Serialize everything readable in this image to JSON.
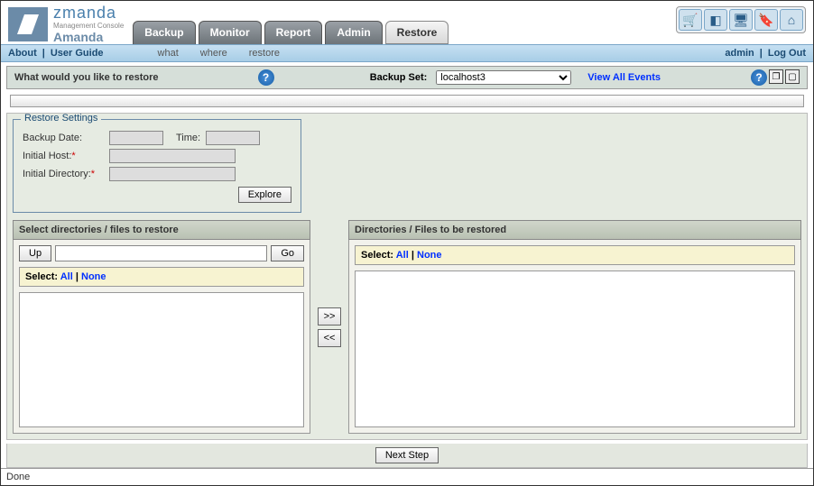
{
  "header": {
    "brand_top": "zmanda",
    "brand_sub": "Management Console",
    "brand_prod": "Amanda",
    "tabs": [
      "Backup",
      "Monitor",
      "Report",
      "Admin",
      "Restore"
    ],
    "active_tab": "Restore"
  },
  "subbar": {
    "about": "About",
    "user_guide": "User Guide",
    "crumbs": [
      "what",
      "where",
      "restore"
    ],
    "admin": "admin",
    "logout": "Log Out"
  },
  "qbar": {
    "question": "What would you like to restore",
    "backup_set_label": "Backup Set:",
    "backup_set_value": "localhost3",
    "view_all": "View All Events"
  },
  "restore_settings": {
    "legend": "Restore Settings",
    "backup_date_label": "Backup Date:",
    "time_label": "Time:",
    "initial_host_label": "Initial Host:",
    "initial_dir_label": "Initial Directory:",
    "backup_date_value": "",
    "time_value": "",
    "initial_host_value": "",
    "initial_dir_value": "",
    "explore_btn": "Explore"
  },
  "panel_left": {
    "title": "Select directories / files to restore",
    "up_btn": "Up",
    "go_btn": "Go",
    "path_value": "",
    "select_label": "Select:",
    "all": "All",
    "none": "None"
  },
  "panel_right": {
    "title": "Directories / Files to be restored",
    "select_label": "Select:",
    "all": "All",
    "none": "None"
  },
  "transfer": {
    "add": ">>",
    "remove": "<<"
  },
  "footer": {
    "next_step": "Next Step",
    "status": "Done"
  },
  "sep": "|"
}
